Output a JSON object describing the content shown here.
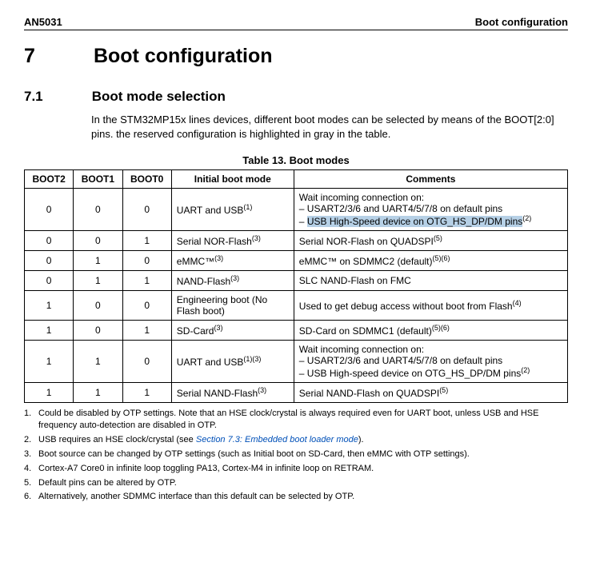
{
  "header": {
    "doc_id": "AN5031",
    "right": "Boot configuration"
  },
  "section": {
    "num": "7",
    "title": "Boot configuration"
  },
  "subsection": {
    "num": "7.1",
    "title": "Boot mode selection"
  },
  "intro": "In the STM32MP15x lines devices, different boot modes can be selected by means of the BOOT[2:0] pins. the reserved configuration is highlighted in gray in the table.",
  "table": {
    "caption": "Table 13. Boot modes",
    "headers": {
      "b2": "BOOT2",
      "b1": "BOOT1",
      "b0": "BOOT0",
      "mode": "Initial boot mode",
      "comments": "Comments"
    },
    "rows": [
      {
        "b2": "0",
        "b1": "0",
        "b0": "0",
        "mode": "UART and USB",
        "mode_sup": "(1)",
        "comments_line1": "Wait incoming connection on:",
        "comments_line2": "– USART2/3/6 and UART4/5/7/8 on default pins",
        "comments_line3": "– ",
        "comments_hl": "USB High-Speed device on OTG_HS_DP/DM pins",
        "comments_sup": "(2)"
      },
      {
        "b2": "0",
        "b1": "0",
        "b0": "1",
        "mode": "Serial NOR-Flash",
        "mode_sup": "(3)",
        "comments": "Serial NOR-Flash on QUADSPI",
        "comments_sup": "(5)"
      },
      {
        "b2": "0",
        "b1": "1",
        "b0": "0",
        "mode": "eMMC™",
        "mode_sup": "(3)",
        "comments": "eMMC™ on SDMMC2 (default)",
        "comments_sup": "(5)(6)"
      },
      {
        "b2": "0",
        "b1": "1",
        "b0": "1",
        "mode": "NAND-Flash",
        "mode_sup": "(3)",
        "comments": "SLC NAND-Flash on FMC"
      },
      {
        "b2": "1",
        "b1": "0",
        "b0": "0",
        "mode": "Engineering boot (No Flash boot)",
        "comments": "Used to get debug access without boot from Flash",
        "comments_sup": "(4)"
      },
      {
        "b2": "1",
        "b1": "0",
        "b0": "1",
        "mode": "SD-Card",
        "mode_sup": "(3)",
        "comments": "SD-Card on SDMMC1 (default)",
        "comments_sup": "(5)(6)"
      },
      {
        "b2": "1",
        "b1": "1",
        "b0": "0",
        "mode": "UART and USB",
        "mode_sup": "(1)(3)",
        "comments_line1": "Wait incoming connection on:",
        "comments_line2": "– USART2/3/6 and UART4/5/7/8 on default pins",
        "comments_line3": "– USB High-speed device on OTG_HS_DP/DM pins",
        "comments_sup": "(2)"
      },
      {
        "b2": "1",
        "b1": "1",
        "b0": "1",
        "mode": "Serial NAND-Flash",
        "mode_sup": "(3)",
        "comments": "Serial NAND-Flash on QUADSPI",
        "comments_sup": "(5)"
      }
    ]
  },
  "footnotes": {
    "f1": "Could be disabled by OTP settings. Note that an HSE clock/crystal is always required even for UART boot, unless USB and HSE frequency auto-detection are disabled in OTP.",
    "f2_a": "USB requires an HSE clock/crystal (see ",
    "f2_link": "Section 7.3: Embedded boot loader mode",
    "f2_b": ").",
    "f3": "Boot source can be changed by OTP settings (such as Initial boot on SD-Card, then eMMC with OTP settings).",
    "f4": "Cortex-A7 Core0 in infinite loop toggling PA13, Cortex-M4 in infinite loop on RETRAM.",
    "f5": "Default pins can be altered by OTP.",
    "f6": "Alternatively, another SDMMC interface than this default can be selected by OTP."
  }
}
